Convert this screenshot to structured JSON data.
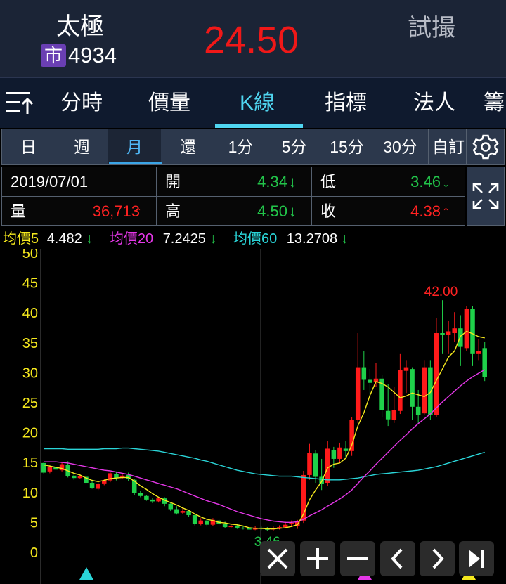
{
  "header": {
    "name": "太極",
    "market": "市",
    "code": "4934",
    "price": "24.50",
    "trial": "試撮"
  },
  "tabs": [
    "分時",
    "價量",
    "K線",
    "指標",
    "法人"
  ],
  "periods": [
    "日",
    "週",
    "月",
    "還",
    "1分",
    "5分",
    "15分",
    "30分",
    "自訂"
  ],
  "info": {
    "date": "2019/07/01",
    "vol_label": "量",
    "vol": "36,713",
    "vol_arrow": "↑",
    "open_label": "開",
    "open": "4.34",
    "open_arrow": "↓",
    "high_label": "高",
    "high": "4.50",
    "high_arrow": "↓",
    "low_label": "低",
    "low": "3.46",
    "low_arrow": "↓",
    "close_label": "收",
    "close": "4.38",
    "close_arrow": "↑"
  },
  "ma": {
    "ma5_label": "均價5",
    "ma5": "4.482",
    "ma5_arrow": "↓",
    "ma20_label": "均價20",
    "ma20": "7.2425",
    "ma20_arrow": "↓",
    "ma60_label": "均價60",
    "ma60": "13.2708",
    "ma60_arrow": "↓"
  },
  "chart_data": {
    "type": "candlestick",
    "y_ticks": [
      50,
      45,
      40,
      35,
      30,
      25,
      20,
      15,
      10,
      5,
      0
    ],
    "ylim": [
      0,
      50
    ],
    "high_label": "42.00",
    "low_label": "3.46",
    "colors": {
      "up": "#ff1a1a",
      "down": "#1fd14a",
      "ma5": "#f5e81d",
      "ma20": "#e537e8",
      "ma60": "#2ad5d8"
    },
    "candles": [
      [
        14.8,
        13.2,
        15,
        13
      ],
      [
        13.4,
        14.2,
        14.5,
        13.1
      ],
      [
        14.2,
        13.7,
        14.8,
        13.5
      ],
      [
        13.6,
        14.6,
        15,
        13.4
      ],
      [
        14.5,
        12.6,
        15.1,
        12.4
      ],
      [
        12.7,
        12.3,
        13,
        12
      ],
      [
        12.3,
        12.6,
        13,
        12.2
      ],
      [
        12.5,
        11.5,
        12.8,
        11.2
      ],
      [
        11.5,
        10.6,
        12,
        10.5
      ],
      [
        10.5,
        11.3,
        11.7,
        10.3
      ],
      [
        11.4,
        11.9,
        12.2,
        11.1
      ],
      [
        11.9,
        13.1,
        13.4,
        11.6
      ],
      [
        13,
        12.3,
        13.4,
        11.9
      ],
      [
        12.3,
        12.7,
        13.1,
        12.2
      ],
      [
        12.8,
        12.1,
        13.2,
        11.8
      ],
      [
        12,
        9.8,
        12.2,
        9.5
      ],
      [
        9.8,
        9.3,
        10.2,
        9.1
      ],
      [
        9.3,
        8.7,
        9.5,
        8.5
      ],
      [
        8.7,
        8.4,
        9,
        8.1
      ],
      [
        8.4,
        8.9,
        9.2,
        8.2
      ],
      [
        8.9,
        8,
        9.1,
        7.6
      ],
      [
        8,
        7.1,
        8.2,
        6.8
      ],
      [
        7.1,
        6.4,
        7.6,
        6.2
      ],
      [
        6.5,
        6.8,
        7.2,
        6.3
      ],
      [
        6.8,
        6.1,
        7,
        5.8
      ],
      [
        6.1,
        4.6,
        6.3,
        4.4
      ],
      [
        4.6,
        5.2,
        5.6,
        4.4
      ],
      [
        5.2,
        4.5,
        5.4,
        4.2
      ],
      [
        4.5,
        5.3,
        5.6,
        4.3
      ],
      [
        5.2,
        4.6,
        5.5,
        4.3
      ],
      [
        4.6,
        4.1,
        5,
        3.9
      ],
      [
        4.1,
        4.3,
        4.6,
        3.9
      ],
      [
        4.3,
        4,
        4.5,
        3.8
      ],
      [
        4,
        3.9,
        4.3,
        3.7
      ],
      [
        3.9,
        3.7,
        4.1,
        3.6
      ],
      [
        3.7,
        4,
        4.3,
        3.6
      ],
      [
        4,
        3.8,
        4.2,
        3.6
      ],
      [
        3.8,
        3.7,
        4.1,
        3.5
      ],
      [
        3.7,
        3.9,
        4.2,
        3.5
      ],
      [
        3.9,
        4.1,
        4.4,
        3.7
      ],
      [
        4.1,
        4.5,
        5,
        3.9
      ],
      [
        4.6,
        4.8,
        5.2,
        4.2
      ],
      [
        4.3,
        5.1,
        5.3,
        3.8
      ],
      [
        5.2,
        12.8,
        13.5,
        4.8
      ],
      [
        12.8,
        16.5,
        18,
        12
      ],
      [
        16.4,
        12.5,
        17,
        11.5
      ],
      [
        12.5,
        11.3,
        15.5,
        10.3
      ],
      [
        11.5,
        17.2,
        18.5,
        11
      ],
      [
        17,
        15.5,
        17.5,
        14
      ],
      [
        15.5,
        17.4,
        18.2,
        14.8
      ],
      [
        17.2,
        16.8,
        18.5,
        15.5
      ],
      [
        16.8,
        22,
        22.5,
        16
      ],
      [
        22,
        30.8,
        36.5,
        21.5
      ],
      [
        30.8,
        28.7,
        33.5,
        27
      ],
      [
        28.7,
        28.2,
        30.5,
        26
      ],
      [
        28.4,
        28.9,
        31.5,
        27.5
      ],
      [
        28.9,
        23.6,
        29.5,
        22.5
      ],
      [
        23.5,
        22.1,
        28,
        21
      ],
      [
        22,
        23.6,
        27.5,
        21.5
      ],
      [
        23.5,
        30.4,
        33,
        23
      ],
      [
        30.2,
        30.8,
        32,
        26.5
      ],
      [
        30.5,
        24.2,
        30.8,
        22
      ],
      [
        24.2,
        22.8,
        27,
        21.5
      ],
      [
        23.1,
        30.8,
        32,
        22.8
      ],
      [
        30.8,
        22.8,
        32,
        22
      ],
      [
        22.8,
        36.5,
        39,
        22.5
      ],
      [
        36.5,
        36.2,
        42,
        33
      ],
      [
        36.2,
        36.8,
        38.5,
        33
      ],
      [
        36.5,
        37.3,
        40,
        35
      ],
      [
        37.3,
        34.2,
        39.5,
        31
      ],
      [
        34,
        40.5,
        41,
        33.5
      ],
      [
        40.5,
        33,
        41,
        31
      ],
      [
        33,
        33.5,
        35.5,
        32
      ],
      [
        34,
        29.2,
        35,
        28.5
      ]
    ],
    "ma5": [
      14.5,
      14.3,
      14.1,
      13.9,
      13.5,
      13.1,
      12.8,
      12.3,
      11.9,
      11.7,
      11.9,
      12.2,
      12.3,
      12.4,
      12.4,
      11.8,
      11,
      10.4,
      9.7,
      9.1,
      8.6,
      8.2,
      7.8,
      7.3,
      6.9,
      6.3,
      5.8,
      5.4,
      5.2,
      4.9,
      4.8,
      4.6,
      4.5,
      4.3,
      4,
      3.9,
      3.9,
      3.8,
      3.8,
      3.9,
      4,
      4.2,
      4.5,
      6.3,
      8.7,
      10.3,
      11.7,
      14,
      14.6,
      14.8,
      15.6,
      17.8,
      21,
      23.2,
      26.1,
      28.4,
      28.1,
      27.5,
      26.6,
      25.7,
      26,
      26.5,
      26.2,
      25.9,
      26.6,
      28.6,
      30.5,
      32.5,
      33.5,
      36,
      36.8,
      36.4,
      35.9,
      35.7
    ],
    "ma20": [
      15,
      15,
      15,
      14.9,
      14.8,
      14.6,
      14.4,
      14.2,
      14,
      13.8,
      13.6,
      13.5,
      13.3,
      13.1,
      12.9,
      12.6,
      12.3,
      12,
      11.7,
      11.4,
      11.1,
      10.8,
      10.5,
      10.1,
      9.7,
      9.3,
      8.9,
      8.5,
      8.2,
      7.9,
      7.5,
      7.1,
      6.7,
      6.4,
      6.1,
      5.8,
      5.5,
      5.3,
      5.1,
      5,
      4.9,
      4.9,
      5,
      5.4,
      6,
      6.5,
      7,
      7.6,
      8.2,
      8.8,
      9.5,
      10.3,
      11.4,
      12.5,
      13.5,
      14.6,
      15.6,
      16.6,
      17.6,
      18.6,
      19.5,
      20.5,
      21.4,
      22.2,
      23,
      24,
      25,
      25.9,
      26.8,
      27.7,
      28.5,
      29.2,
      29.8,
      30.4
    ],
    "ma60": [
      17.2,
      17.2,
      17.2,
      17.2,
      17.1,
      17.1,
      17.1,
      17.1,
      17.1,
      17.1,
      17.2,
      17.2,
      17.2,
      17.3,
      17.3,
      17.2,
      17.1,
      17,
      16.9,
      16.8,
      16.6,
      16.4,
      16.2,
      16,
      15.8,
      15.6,
      15.3,
      15.1,
      14.8,
      14.5,
      14.2,
      13.9,
      13.6,
      13.4,
      13.2,
      13,
      12.9,
      12.8,
      12.7,
      12.6,
      12.6,
      12.6,
      12.5,
      12.4,
      12.3,
      12.2,
      12.1,
      12,
      12,
      12,
      12.1,
      12.2,
      12.3,
      12.5,
      12.7,
      12.9,
      13,
      13.1,
      13.2,
      13.3,
      13.4,
      13.5,
      13.6,
      13.8,
      14,
      14.2,
      14.5,
      14.8,
      15.1,
      15.4,
      15.7,
      16,
      16.3,
      16.6
    ]
  },
  "toolbar": [
    "✕",
    "+",
    "−",
    "‹",
    "›",
    "▶|"
  ]
}
